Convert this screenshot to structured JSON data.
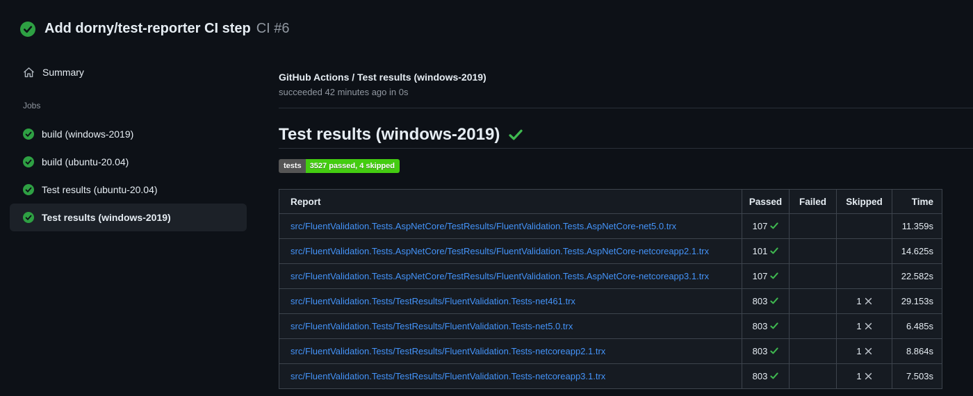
{
  "run_header": {
    "title": "Add dorny/test-reporter CI step",
    "run_number": "CI #6",
    "status": "success"
  },
  "sidebar": {
    "summary_label": "Summary",
    "jobs_section_label": "Jobs",
    "jobs": [
      {
        "label": "build (windows-2019)",
        "status": "success",
        "selected": false
      },
      {
        "label": "build (ubuntu-20.04)",
        "status": "success",
        "selected": false
      },
      {
        "label": "Test results (ubuntu-20.04)",
        "status": "success",
        "selected": false
      },
      {
        "label": "Test results (windows-2019)",
        "status": "success",
        "selected": true
      }
    ]
  },
  "main": {
    "breadcrumb_title": "GitHub Actions / Test results (windows-2019)",
    "status_line": "succeeded 42 minutes ago in 0s",
    "section_heading": "Test results (windows-2019)",
    "badge": {
      "label": "tests",
      "value": "3527 passed, 4 skipped",
      "label_bg": "#555555",
      "value_bg": "#44cc11"
    },
    "table": {
      "headers": [
        "Report",
        "Passed",
        "Failed",
        "Skipped",
        "Time"
      ],
      "rows": [
        {
          "report": "src/FluentValidation.Tests.AspNetCore/TestResults/FluentValidation.Tests.AspNetCore-net5.0.trx",
          "passed": "107",
          "failed": "",
          "skipped": "",
          "time": "11.359s"
        },
        {
          "report": "src/FluentValidation.Tests.AspNetCore/TestResults/FluentValidation.Tests.AspNetCore-netcoreapp2.1.trx",
          "passed": "101",
          "failed": "",
          "skipped": "",
          "time": "14.625s"
        },
        {
          "report": "src/FluentValidation.Tests.AspNetCore/TestResults/FluentValidation.Tests.AspNetCore-netcoreapp3.1.trx",
          "passed": "107",
          "failed": "",
          "skipped": "",
          "time": "22.582s"
        },
        {
          "report": "src/FluentValidation.Tests/TestResults/FluentValidation.Tests-net461.trx",
          "passed": "803",
          "failed": "",
          "skipped": "1",
          "time": "29.153s"
        },
        {
          "report": "src/FluentValidation.Tests/TestResults/FluentValidation.Tests-net5.0.trx",
          "passed": "803",
          "failed": "",
          "skipped": "1",
          "time": "6.485s"
        },
        {
          "report": "src/FluentValidation.Tests/TestResults/FluentValidation.Tests-netcoreapp2.1.trx",
          "passed": "803",
          "failed": "",
          "skipped": "1",
          "time": "8.864s"
        },
        {
          "report": "src/FluentValidation.Tests/TestResults/FluentValidation.Tests-netcoreapp3.1.trx",
          "passed": "803",
          "failed": "",
          "skipped": "1",
          "time": "7.503s"
        }
      ]
    }
  },
  "colors": {
    "page_bg": "#0d1117",
    "table_cell_bg": "#161b22",
    "table_border": "#3d444d",
    "success_circle_green": "#2ea043",
    "check_green": "#3fb950",
    "link_blue": "#4493f8",
    "secondary_text": "#9198a1",
    "selected_item_bg": "#1c2128",
    "skipped_x_gray": "#bcc2ca"
  }
}
